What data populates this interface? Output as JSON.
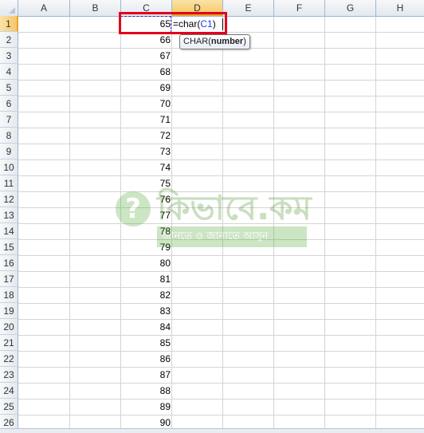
{
  "columns": [
    "A",
    "B",
    "C",
    "D",
    "E",
    "F",
    "G",
    "H"
  ],
  "active_column": "D",
  "rows": [
    "1",
    "2",
    "3",
    "4",
    "5",
    "6",
    "7",
    "8",
    "9",
    "10",
    "11",
    "12",
    "13",
    "14",
    "15",
    "16",
    "17",
    "18",
    "19",
    "20",
    "21",
    "22",
    "23",
    "24",
    "25",
    "26"
  ],
  "active_row": "1",
  "column_c_values": [
    "65",
    "66",
    "67",
    "68",
    "69",
    "70",
    "71",
    "72",
    "73",
    "74",
    "75",
    "76",
    "77",
    "78",
    "79",
    "80",
    "81",
    "82",
    "83",
    "84",
    "85",
    "86",
    "87",
    "88",
    "89",
    "90"
  ],
  "formula": {
    "prefix": "=char(",
    "reference": "C1",
    "suffix": ")"
  },
  "tooltip": {
    "function_name": "CHAR(",
    "argument": "number",
    "close": ")"
  },
  "watermark": {
    "logo_glyph": "?",
    "title": "কিভাবে.কম",
    "subtitle": "জানতে ও জানাতে আসুন",
    "color": "#4aa32a"
  },
  "colors": {
    "highlight_box": "#e2001a",
    "active_header": "#f6c768",
    "cell_reference": "#1f3ff0"
  }
}
